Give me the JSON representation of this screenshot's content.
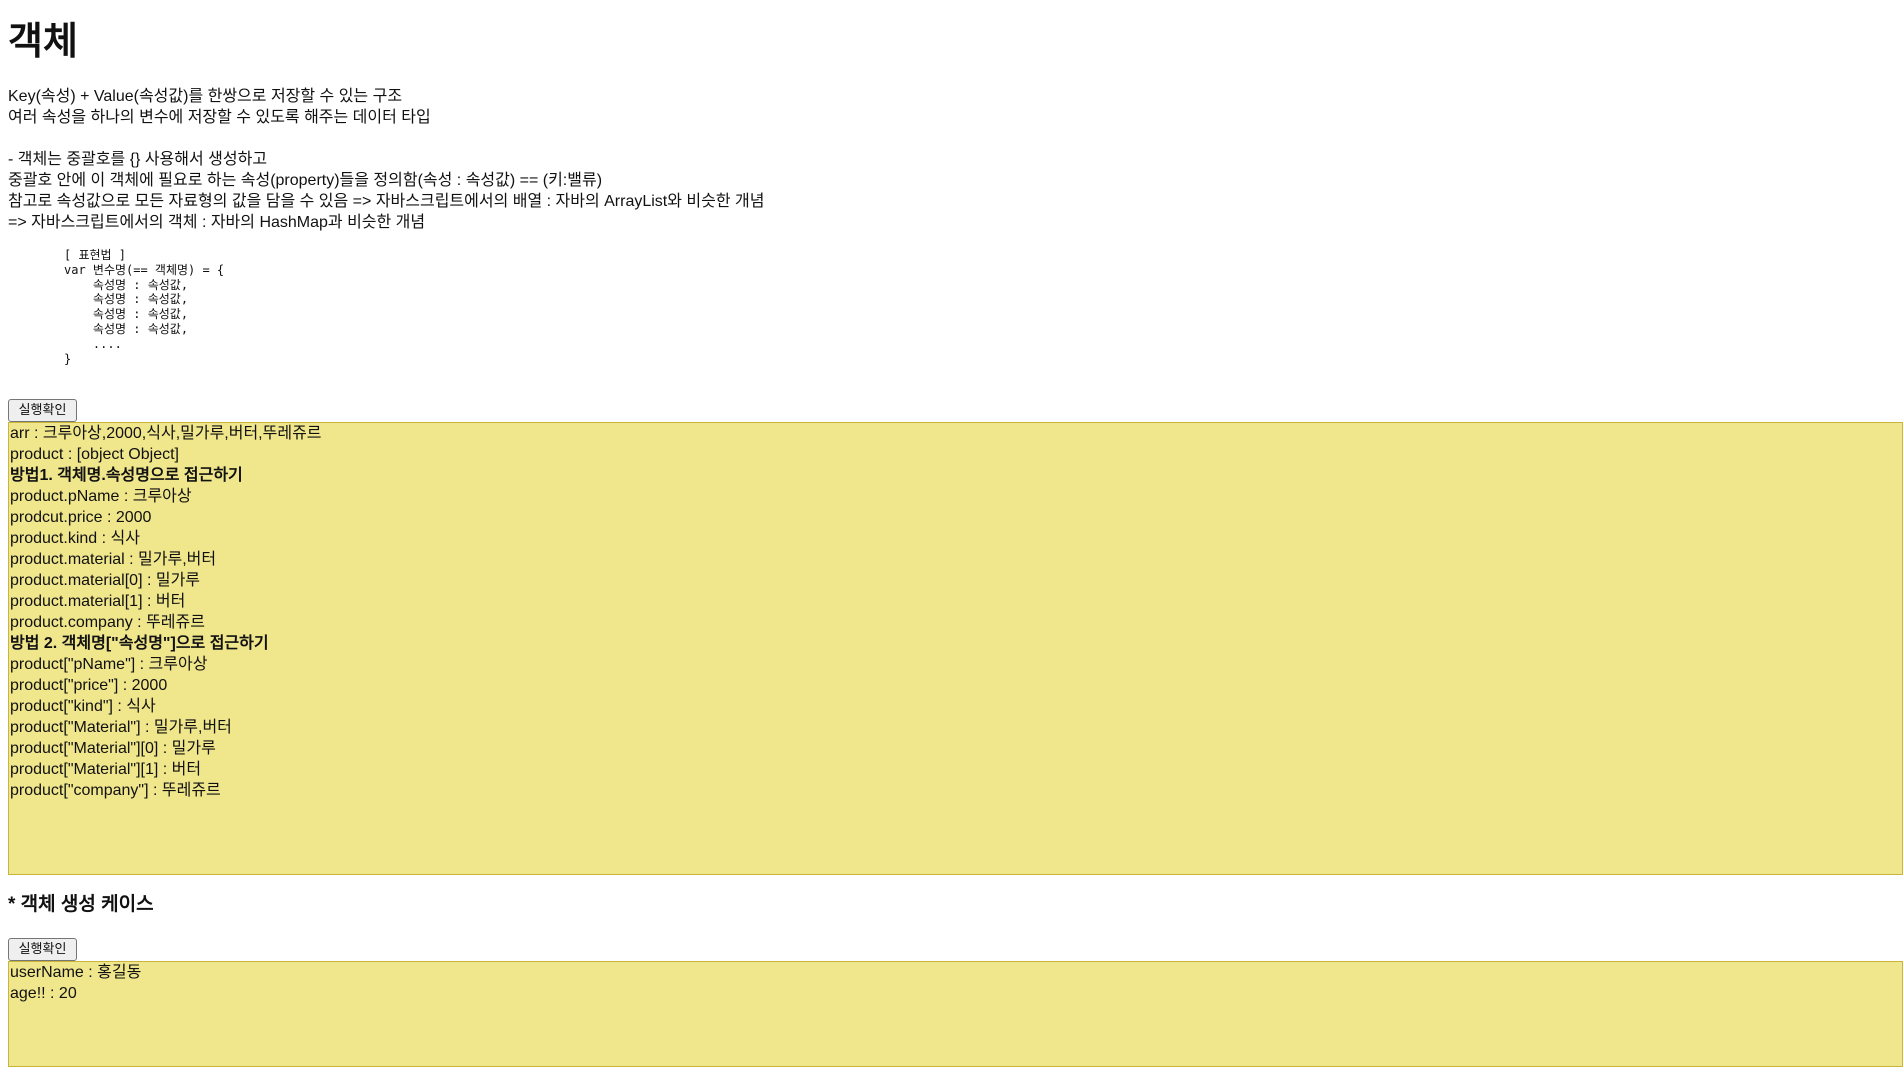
{
  "title": "객체",
  "intro": {
    "line1": "Key(속성) + Value(속성값)를 한쌍으로 저장할 수 있는 구조",
    "line2": "여러 속성을 하나의 변수에 저장할 수 있도록 해주는 데이터 타입"
  },
  "details": {
    "line1": "- 객체는 중괄호를 {} 사용해서 생성하고",
    "line2": "중괄호 안에 이 객체에 필요로 하는 속성(property)들을 정의함(속성 : 속성값) == (키:밸류)",
    "line3": "참고로 속성값으로 모든 자료형의 값을 담을 수 있음 => 자바스크립트에서의 배열 : 자바의 ArrayList와 비슷한 개념",
    "line4": "=> 자바스크립트에서의 객체 : 자바의 HashMap과 비슷한 개념"
  },
  "code": {
    "line1": "[ 표현법 ]",
    "line2": "var 변수명(== 객체명) = {",
    "line3": "    속성명 : 속성값,",
    "line4": "    속성명 : 속성값,",
    "line5": "    속성명 : 속성값,",
    "line6": "    속성명 : 속성값,",
    "line7": "    ....",
    "line8": "}"
  },
  "button1": {
    "label": "실행확인"
  },
  "output1": {
    "lines": [
      "arr : 크루아상,2000,식사,밀가루,버터,뚜레쥬르",
      "product : [object Object]",
      "방법1. 객체명.속성명으로 접근하기",
      "product.pName : 크루아상",
      "prodcut.price : 2000",
      "product.kind : 식사",
      "product.material : 밀가루,버터",
      "product.material[0] : 밀가루",
      "product.material[1] : 버터",
      "product.company : 뚜레쥬르",
      "방법 2. 객체명[\"속성명\"]으로 접근하기",
      "product[\"pName\"] : 크루아상",
      "product[\"price\"] : 2000",
      "product[\"kind\"] : 식사",
      "product[\"Material\"] : 밀가루,버터",
      "product[\"Material\"][0] : 밀가루",
      "product[\"Material\"][1] : 버터",
      "product[\"company\"] : 뚜레쥬르"
    ]
  },
  "section2": {
    "heading": "* 객체 생성 케이스"
  },
  "button2": {
    "label": "실행확인"
  },
  "output2": {
    "lines": [
      "userName : 홍길동",
      "age!! : 20"
    ]
  },
  "colors": {
    "output_background": "#f0e68c",
    "output_border": "#c9b53a"
  }
}
